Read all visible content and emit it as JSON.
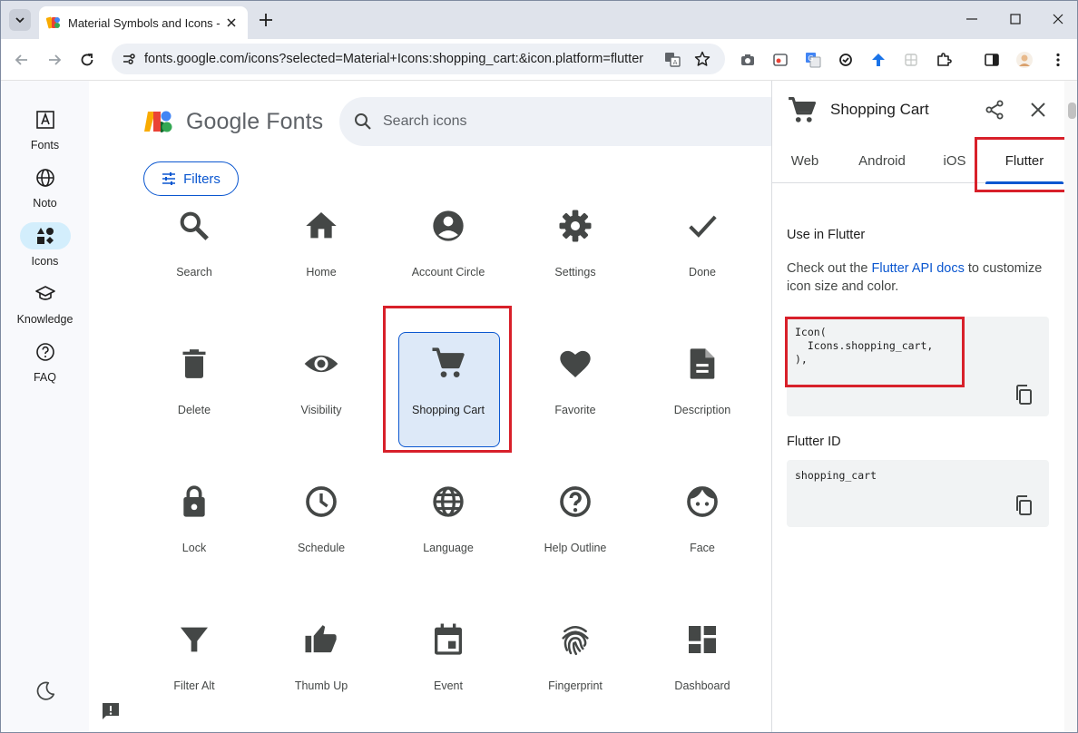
{
  "browser": {
    "tab_title": "Material Symbols and Icons - Google Fonts",
    "url": "fonts.google.com/icons?selected=Material+Icons:shopping_cart:&icon.platform=flutter"
  },
  "rail": {
    "items": [
      {
        "label": "Fonts",
        "icon": "font-icon"
      },
      {
        "label": "Noto",
        "icon": "globe-icon"
      },
      {
        "label": "Icons",
        "icon": "shapes-icon",
        "active": true
      },
      {
        "label": "Knowledge",
        "icon": "school-icon"
      },
      {
        "label": "FAQ",
        "icon": "help-icon"
      }
    ]
  },
  "header": {
    "logo_text": "Google Fonts",
    "search_placeholder": "Search icons",
    "filters_label": "Filters"
  },
  "icons": [
    {
      "name": "Search",
      "icon": "search-icon"
    },
    {
      "name": "Home",
      "icon": "home-icon"
    },
    {
      "name": "Account Circle",
      "icon": "account-circle-icon"
    },
    {
      "name": "Settings",
      "icon": "settings-icon"
    },
    {
      "name": "Done",
      "icon": "check-icon"
    },
    {
      "name": "Delete",
      "icon": "delete-icon"
    },
    {
      "name": "Visibility",
      "icon": "eye-icon"
    },
    {
      "name": "Shopping Cart",
      "icon": "shopping-cart-icon",
      "selected": true
    },
    {
      "name": "Favorite",
      "icon": "heart-icon"
    },
    {
      "name": "Description",
      "icon": "description-icon"
    },
    {
      "name": "Lock",
      "icon": "lock-icon"
    },
    {
      "name": "Schedule",
      "icon": "clock-icon"
    },
    {
      "name": "Language",
      "icon": "language-icon"
    },
    {
      "name": "Help Outline",
      "icon": "help-outline-icon"
    },
    {
      "name": "Face",
      "icon": "face-icon"
    },
    {
      "name": "Filter Alt",
      "icon": "filter-icon"
    },
    {
      "name": "Thumb Up",
      "icon": "thumb-up-icon"
    },
    {
      "name": "Event",
      "icon": "event-icon"
    },
    {
      "name": "Fingerprint",
      "icon": "fingerprint-icon"
    },
    {
      "name": "Dashboard",
      "icon": "dashboard-icon"
    }
  ],
  "panel": {
    "title": "Shopping Cart",
    "tabs": [
      "Web",
      "Android",
      "iOS",
      "Flutter"
    ],
    "active_tab": "Flutter",
    "use_heading": "Use in Flutter",
    "desc_before": "Check out the ",
    "desc_link": "Flutter API docs",
    "desc_after": " to customize icon size and color.",
    "code": "Icon(\n  Icons.shopping_cart,\n),",
    "id_heading": "Flutter ID",
    "id_value": "shopping_cart"
  },
  "colors": {
    "accent": "#0b57d0",
    "highlight": "#d8202a",
    "icon_gray": "#444746"
  }
}
